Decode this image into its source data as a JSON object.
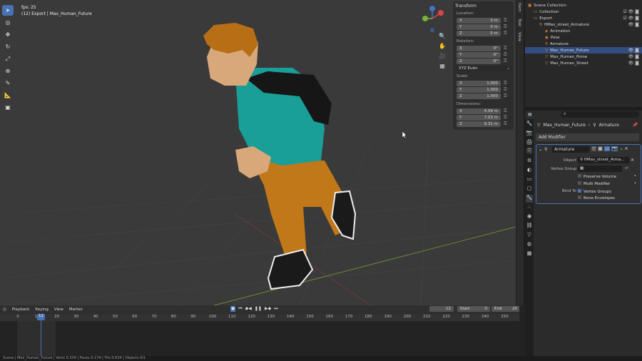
{
  "viewport": {
    "fps": "fps: 25",
    "object_info": "(12) Export | Max_Human_Future",
    "tools": [
      "cursor-icon",
      "select-box-icon",
      "move-icon",
      "rotate-icon",
      "scale-icon",
      "transform-icon",
      "annotate-icon",
      "measure-icon",
      "add-cube-icon"
    ]
  },
  "npanel": {
    "tabs": [
      "Item",
      "Tool",
      "View"
    ],
    "header": "Transform",
    "location_label": "Location:",
    "rotation_label": "Rotation:",
    "scale_label": "Scale:",
    "dimensions_label": "Dimensions:",
    "location": [
      {
        "axis": "X",
        "value": "0 m"
      },
      {
        "axis": "Y",
        "value": "0 m"
      },
      {
        "axis": "Z",
        "value": "0 m"
      }
    ],
    "rotation": [
      {
        "axis": "X",
        "value": "0°"
      },
      {
        "axis": "Y",
        "value": "0°"
      },
      {
        "axis": "Z",
        "value": "0°"
      }
    ],
    "rotation_mode": "XYZ Euler",
    "scale": [
      {
        "axis": "X",
        "value": "1.000"
      },
      {
        "axis": "Y",
        "value": "1.000"
      },
      {
        "axis": "Z",
        "value": "1.000"
      }
    ],
    "dimensions": [
      {
        "axis": "X",
        "value": "4.09 m"
      },
      {
        "axis": "Y",
        "value": "7.03 m"
      },
      {
        "axis": "Z",
        "value": "9.31 m"
      }
    ]
  },
  "outliner": {
    "rows": [
      {
        "label": "Scene Collection",
        "indent": 0,
        "icon": "▣",
        "sel": false,
        "vis": ""
      },
      {
        "label": "Collection",
        "indent": 1,
        "icon": "▭",
        "sel": false,
        "vis": "☑ 👁 ◙"
      },
      {
        "label": "Export",
        "indent": 1,
        "icon": "▭",
        "sel": false,
        "vis": "☑ 👁 ◙"
      },
      {
        "label": "HMax_street_Armature",
        "indent": 2,
        "icon": "⚲",
        "sel": false,
        "vis": "👁 ◙"
      },
      {
        "label": "Animation",
        "indent": 3,
        "icon": "◈",
        "sel": false,
        "vis": ""
      },
      {
        "label": "Pose",
        "indent": 3,
        "icon": "◉",
        "sel": false,
        "vis": ""
      },
      {
        "label": "Armature",
        "indent": 3,
        "icon": "⚲",
        "sel": false,
        "vis": ""
      },
      {
        "label": "Max_Human_Future",
        "indent": 3,
        "icon": "▽",
        "sel": true,
        "vis": "👁 ◙"
      },
      {
        "label": "Max_Human_Pome",
        "indent": 3,
        "icon": "▽",
        "sel": false,
        "vis": "👁 ◙"
      },
      {
        "label": "Max_Human_Street",
        "indent": 3,
        "icon": "▽",
        "sel": false,
        "vis": "👁 ◙"
      }
    ]
  },
  "props": {
    "search_placeholder": "",
    "breadcrumb_object": "Max_Human_Future",
    "breadcrumb_modifier": "Armature",
    "add_modifier": "Add Modifier",
    "modifier_name": "Armature",
    "object_label": "Object",
    "object_value": "HMax_street_Arma...",
    "vertex_group_label": "Vertex Group",
    "preserve_volume": "Preserve Volume",
    "multi_modifier": "Multi Modifier",
    "bind_to_label": "Bind To",
    "vertex_groups": "Vertex Groups",
    "bone_envelopes": "Bone Envelopes"
  },
  "timeline": {
    "menus": [
      "Playback",
      "Keying",
      "View",
      "Marker"
    ],
    "current_frame": "12",
    "start_label": "Start",
    "start": "0",
    "end_label": "End",
    "end": "20",
    "ticks": [
      "0",
      "10",
      "20",
      "30",
      "40",
      "50",
      "60",
      "70",
      "80",
      "90",
      "100",
      "110",
      "120",
      "130",
      "140",
      "150",
      "160",
      "170",
      "180",
      "190",
      "200",
      "210",
      "220",
      "230",
      "240",
      "250"
    ],
    "playhead": "12"
  },
  "status": "Scene | Max_Human_Future | Verts 0.334 | Faces 0.174 | Tris 0.634 | Objects 0/1"
}
